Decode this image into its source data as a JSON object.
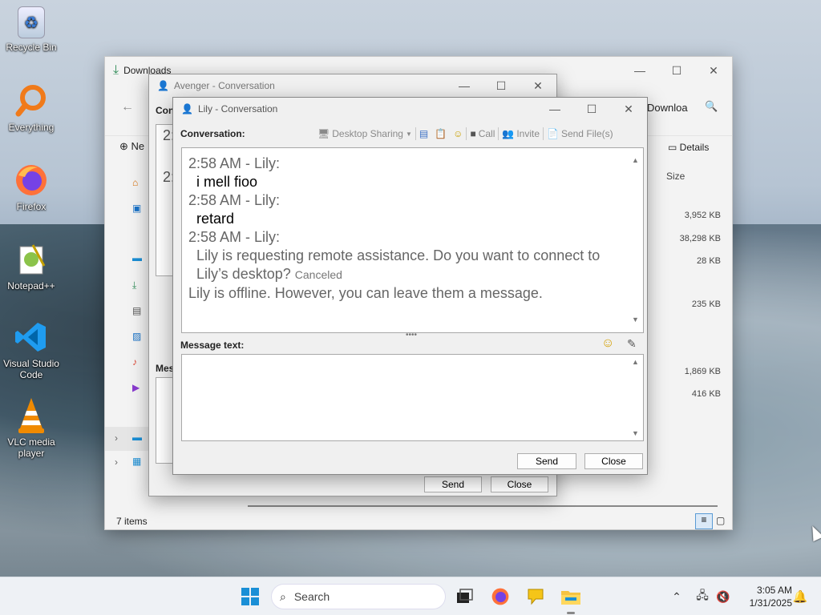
{
  "desktop": {
    "icons": [
      {
        "label": "Recycle Bin",
        "icon": "recycle-bin-icon"
      },
      {
        "label": "Everything",
        "icon": "search-magnifier-icon"
      },
      {
        "label": "Firefox",
        "icon": "firefox-icon"
      },
      {
        "label": "Notepad++",
        "icon": "notepadpp-icon"
      },
      {
        "label": "Visual Studio Code",
        "icon": "vscode-icon"
      },
      {
        "label": "VLC media player",
        "icon": "vlc-icon"
      }
    ]
  },
  "explorer": {
    "title": "Downloads",
    "address": "Downloa",
    "new_label": "Ne",
    "details_label": "Details",
    "size_header": "Size",
    "sizes": [
      "3,952 KB",
      "38,298 KB",
      "28 KB",
      "235 KB",
      "1,869 KB",
      "416 KB"
    ],
    "status": "7 items"
  },
  "avenger": {
    "title": "Avenger - Conversation",
    "conv_label": "Conv",
    "partial_lines": [
      "2:",
      "I",
      "2:"
    ],
    "mes_label": "Mes",
    "send": "Send",
    "close": "Close"
  },
  "lily": {
    "title": "Lily - Conversation",
    "conversation_label": "Conversation:",
    "toolbar": {
      "desktop_sharing": "Desktop Sharing",
      "call": "Call",
      "invite": "Invite",
      "send_files": "Send File(s)"
    },
    "messages": [
      {
        "type": "hdr",
        "text": "2:58 AM - Lily:"
      },
      {
        "type": "msg",
        "text": "i mell fioo"
      },
      {
        "type": "hdr",
        "text": "2:58 AM - Lily:"
      },
      {
        "type": "msg",
        "text": "retard"
      },
      {
        "type": "hdr",
        "text": "2:58 AM - Lily:"
      },
      {
        "type": "sys",
        "text": "Lily is requesting remote assistance. Do you want to connect to"
      },
      {
        "type": "sys2",
        "text": "Lily’s desktop?",
        "tag": "Canceled"
      },
      {
        "type": "plain",
        "text": "Lily is offline. However, you can leave them a message."
      }
    ],
    "message_text_label": "Message text:",
    "send": "Send",
    "close": "Close"
  },
  "taskbar": {
    "search_placeholder": "Search",
    "time": "3:05 AM",
    "date": "1/31/2025"
  }
}
